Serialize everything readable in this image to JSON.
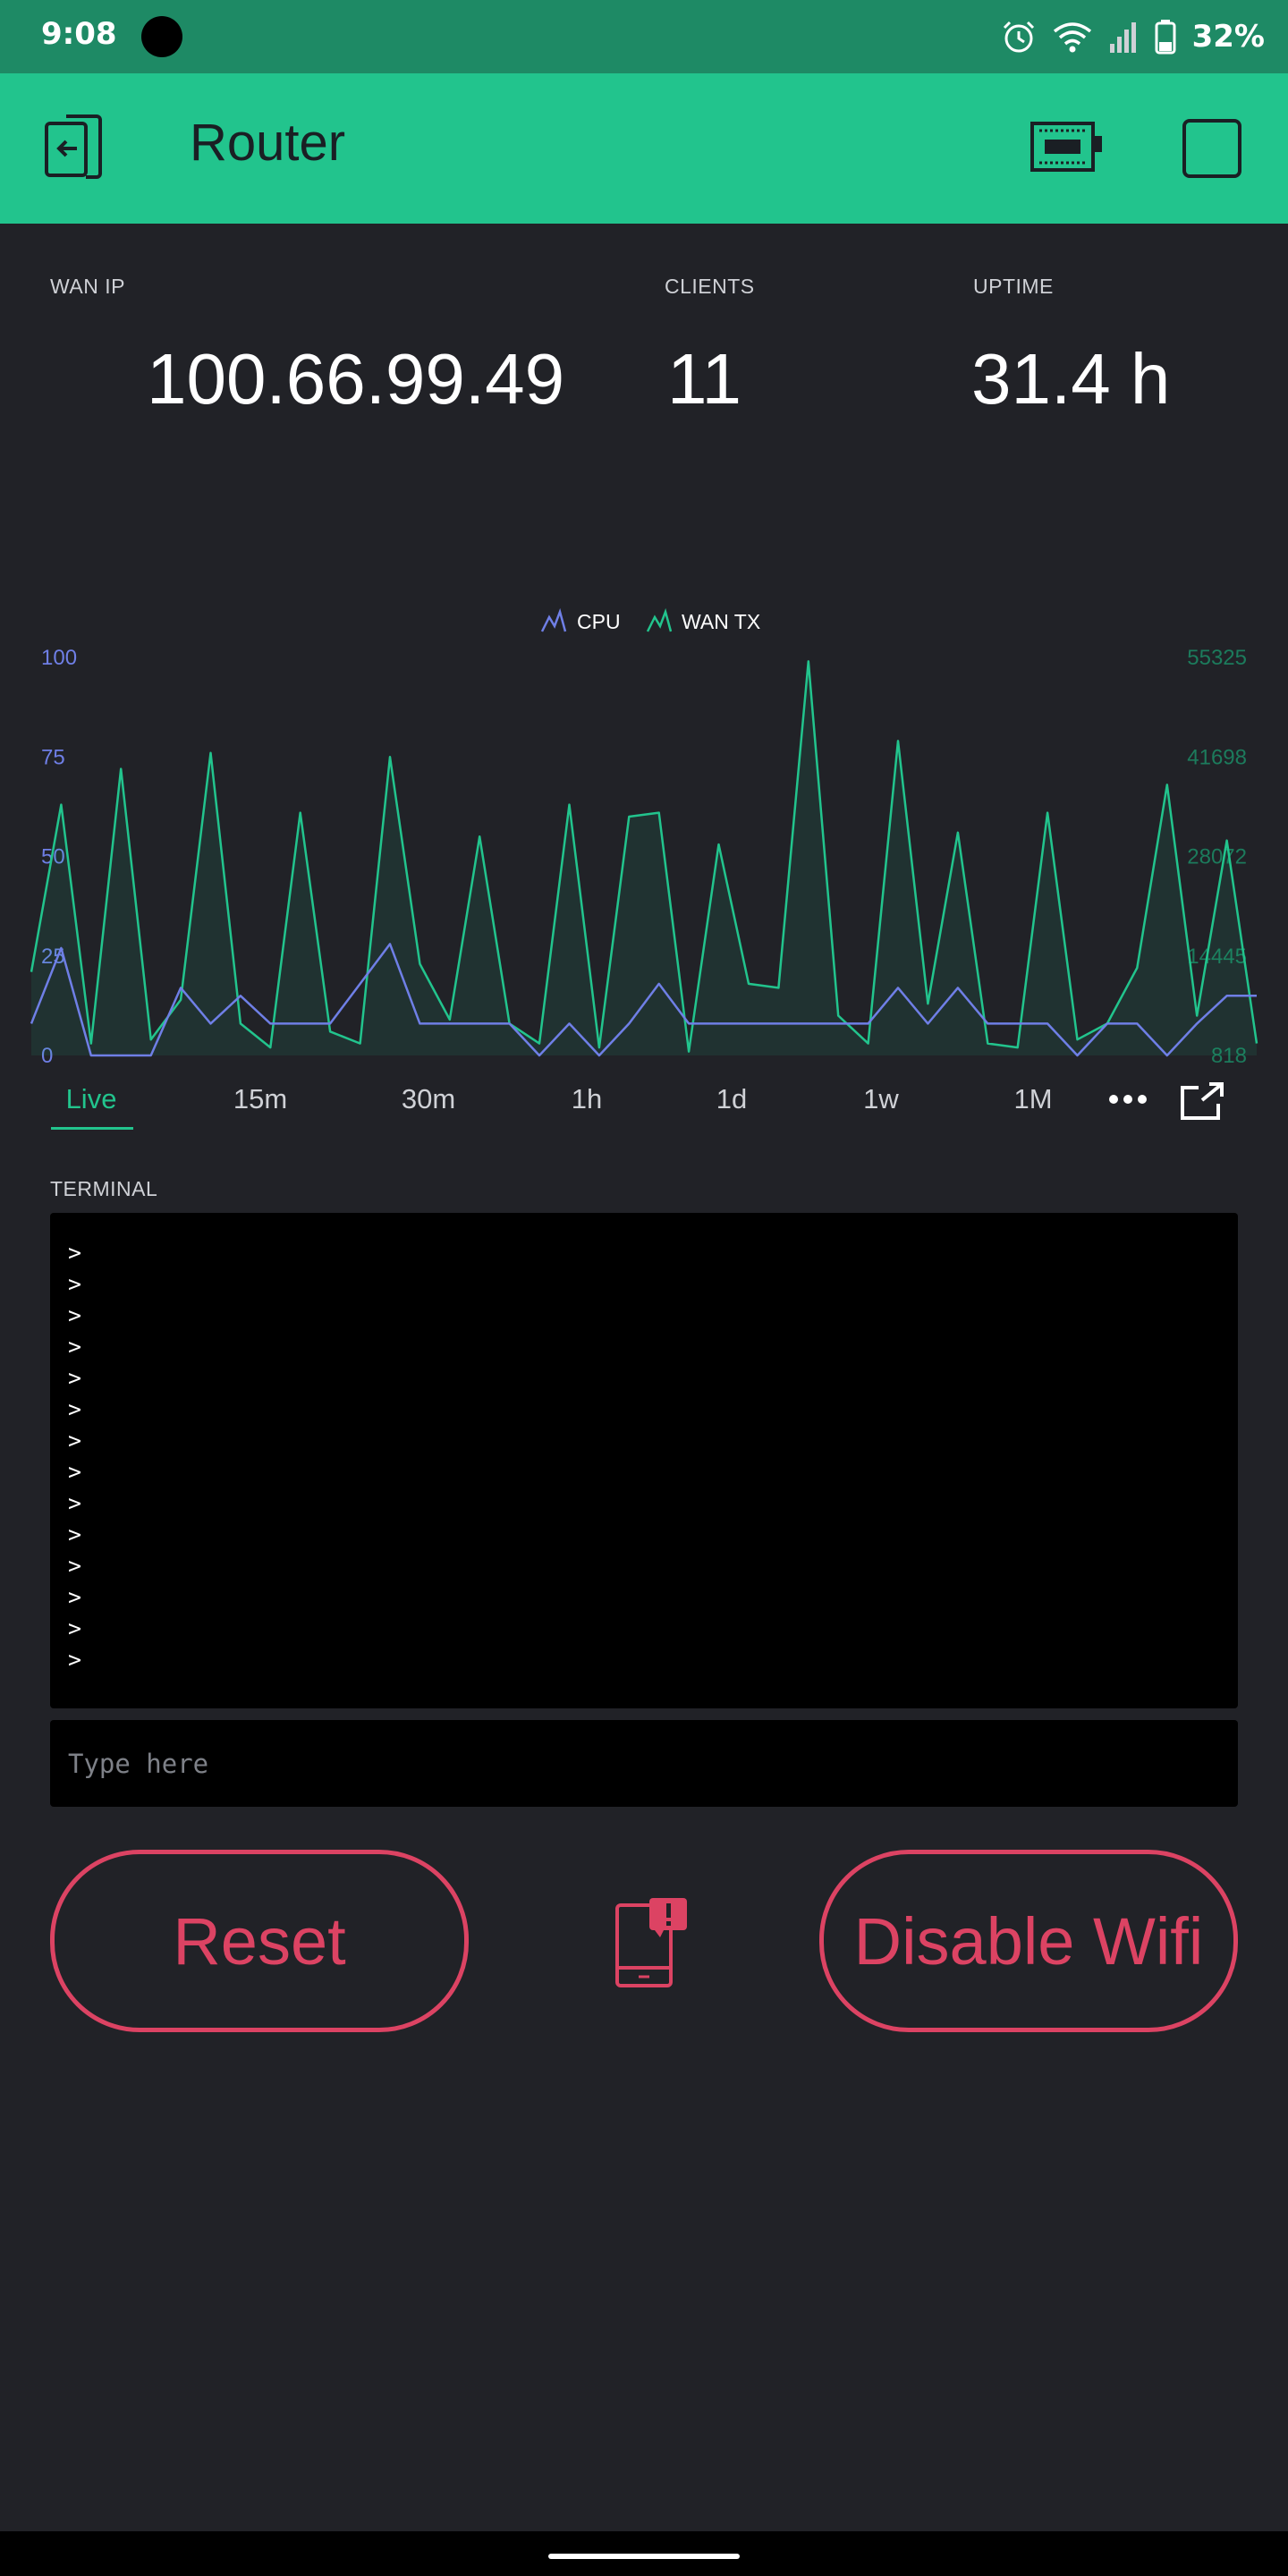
{
  "status_bar": {
    "time": "9:08",
    "battery": "32%"
  },
  "app_bar": {
    "title": "Router"
  },
  "displays": [
    {
      "label": "WAN IP",
      "value": "100.66.99.49"
    },
    {
      "label": "CLIENTS",
      "value": "11"
    },
    {
      "label": "UPTIME",
      "value": "31.4 h"
    }
  ],
  "chart_data": {
    "type": "line",
    "legend": [
      "CPU",
      "WAN TX"
    ],
    "y_left_ticks": [
      "100",
      "75",
      "50",
      "25",
      "0"
    ],
    "y_right_ticks": [
      "55325",
      "41698",
      "28072",
      "14445",
      "818"
    ],
    "ylim_left": [
      0,
      100
    ],
    "series": [
      {
        "name": "CPU",
        "color": "#6f7fe6",
        "values": [
          8,
          27,
          0,
          0,
          0,
          17,
          8,
          15,
          8,
          8,
          8,
          18,
          28,
          8,
          8,
          8,
          8,
          0,
          8,
          0,
          8,
          18,
          8,
          8,
          8,
          8,
          8,
          8,
          8,
          17,
          8,
          17,
          8,
          8,
          8,
          0,
          8,
          8,
          0,
          8,
          15,
          15
        ]
      },
      {
        "name": "WAN TX",
        "color": "#22c48d",
        "values": [
          21,
          63,
          3,
          72,
          4,
          14,
          76,
          8,
          2,
          61,
          6,
          3,
          75,
          23,
          9,
          55,
          8,
          3,
          63,
          2,
          60,
          61,
          1,
          53,
          18,
          17,
          99,
          10,
          3,
          79,
          13,
          56,
          3,
          2,
          61,
          4,
          8,
          22,
          68,
          10,
          54,
          3
        ]
      }
    ],
    "time_tabs": [
      "Live",
      "15m",
      "30m",
      "1h",
      "1d",
      "1w",
      "1M"
    ],
    "active_tab": "Live"
  },
  "terminal": {
    "label": "TERMINAL",
    "lines": [
      ">",
      ">",
      ">",
      ">",
      ">",
      ">",
      ">",
      ">",
      ">",
      ">",
      ">",
      ">",
      ">",
      ">"
    ],
    "input_placeholder": "Type here"
  },
  "buttons": {
    "reset": "Reset",
    "disable_wifi": "Disable Wifi"
  },
  "colors": {
    "accent": "#22c48d",
    "status_bar": "#1e8a65",
    "background": "#212227",
    "button": "#dc4363",
    "cpu_series": "#6f7fe6"
  }
}
